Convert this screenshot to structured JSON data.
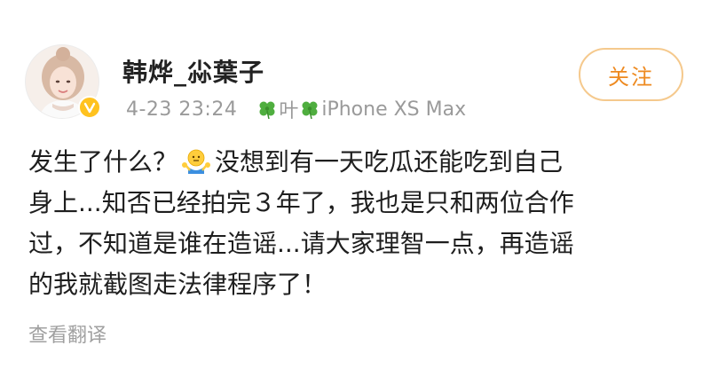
{
  "post": {
    "author": {
      "name": "韩烨_尛葉子",
      "verified": true
    },
    "time": "4-23 23:24",
    "source": {
      "prefix_icon": "four-leaf-clover-icon",
      "text1": "叶",
      "mid_icon": "four-leaf-clover-icon",
      "text2": "iPhone XS Max"
    },
    "follow_label": "关注",
    "content": {
      "line1a": "发生了什么？",
      "emoji": "shrug-emoji-icon",
      "line1b": "没想到有一天吃瓜还能吃到自己",
      "line2": "身上...知否已经拍完３年了，我也是只和两位合作",
      "line3": "过，不知道是谁在造谣...请大家理智一点，再造谣",
      "line4": "的我就截图走法律程序了！"
    },
    "translate_label": "查看翻译"
  },
  "colors": {
    "follow_text": "#ee8a20",
    "follow_border": "#f5c98d",
    "meta_text": "#9a9a9a",
    "verified_badge": "#ffc21f"
  }
}
